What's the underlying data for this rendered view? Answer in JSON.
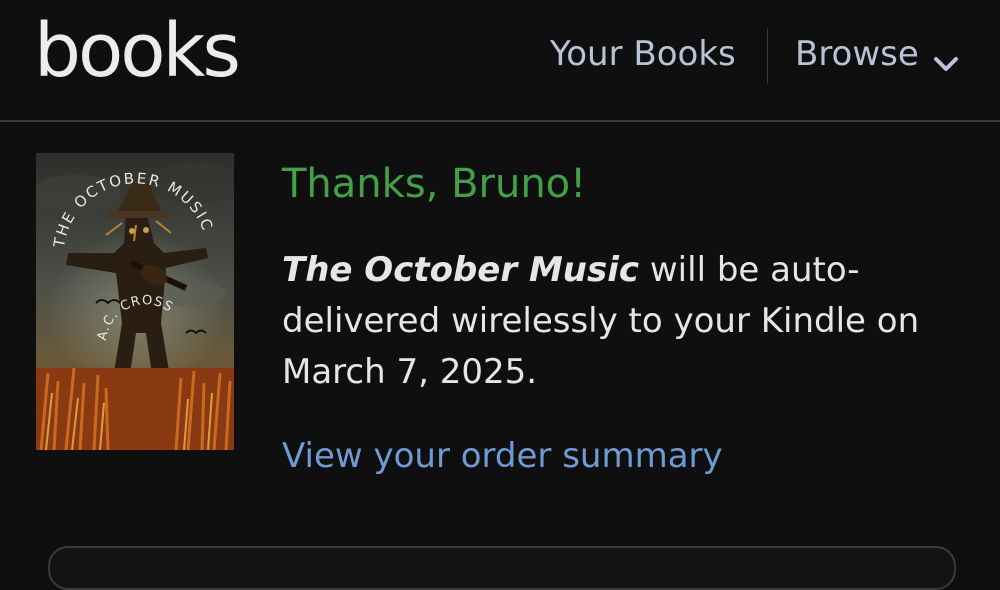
{
  "header": {
    "brand": "books",
    "nav": {
      "your_books": "Your Books",
      "browse": "Browse",
      "browse_icon": "chevron-down-icon"
    }
  },
  "book": {
    "cover": {
      "title_text": "THE OCTOBER MUSIC",
      "author_text": "A.C. CROSS"
    },
    "title": "The October Music"
  },
  "confirmation": {
    "heading": "Thanks, Bruno!",
    "message_suffix": " will be auto-delivered wirelessly to your Kindle on March 7, 2025.",
    "order_link": "View your order summary"
  },
  "colors": {
    "accent_green": "#43a047",
    "link_blue": "#6f9ad3",
    "nav_text": "#b9c3d6"
  }
}
